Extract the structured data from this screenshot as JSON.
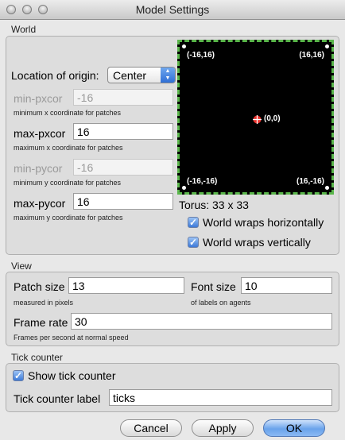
{
  "window": {
    "title": "Model Settings"
  },
  "world": {
    "section_label": "World",
    "origin_label": "Location of origin:",
    "origin_value": "Center",
    "min_pxcor": {
      "label": "min-pxcor",
      "value": "-16",
      "hint": "minimum x coordinate for patches"
    },
    "max_pxcor": {
      "label": "max-pxcor",
      "value": "16",
      "hint": "maximum x coordinate for patches"
    },
    "min_pycor": {
      "label": "min-pycor",
      "value": "-16",
      "hint": "minimum y coordinate for patches"
    },
    "max_pycor": {
      "label": "max-pycor",
      "value": "16",
      "hint": "maximum y coordinate for patches"
    },
    "preview": {
      "top_left": "(-16,16)",
      "top_right": "(16,16)",
      "center": "(0,0)",
      "bottom_left": "(-16,-16)",
      "bottom_right": "(16,-16)",
      "border_color": "#59b54a",
      "origin_marker_color": "#e8322d"
    },
    "torus_label": "Torus: 33 x 33",
    "wrap_horizontal": {
      "label": "World wraps horizontally",
      "checked": true
    },
    "wrap_vertical": {
      "label": "World wraps vertically",
      "checked": true
    }
  },
  "view": {
    "section_label": "View",
    "patch_size": {
      "label": "Patch size",
      "value": "13",
      "hint": "measured in pixels"
    },
    "font_size": {
      "label": "Font size",
      "value": "10",
      "hint": "of labels on agents"
    },
    "frame_rate": {
      "label": "Frame rate",
      "value": "30",
      "hint": "Frames per second at normal speed"
    }
  },
  "tick_counter": {
    "section_label": "Tick counter",
    "show": {
      "label": "Show tick counter",
      "checked": true
    },
    "label_field": {
      "label": "Tick counter label",
      "value": "ticks"
    }
  },
  "buttons": {
    "cancel": "Cancel",
    "apply": "Apply",
    "ok": "OK"
  },
  "colors": {
    "accent": "#3d7ad8",
    "window_bg": "#e8e8e8"
  }
}
